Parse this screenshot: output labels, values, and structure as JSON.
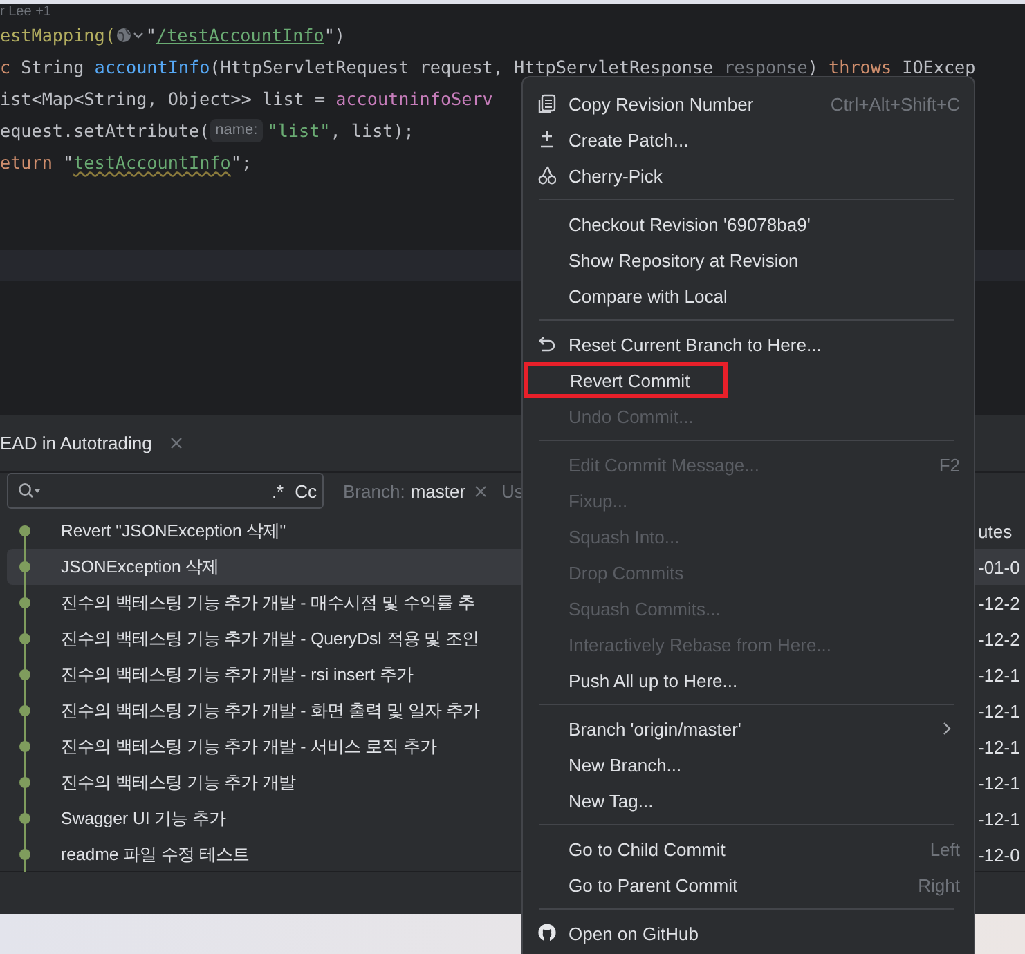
{
  "editor": {
    "author_hint": "r Lee +1",
    "lines": [
      [
        {
          "kind": "annotation",
          "text": "estMapping("
        },
        {
          "kind": "globe"
        },
        {
          "kind": "plain",
          "text": "\""
        },
        {
          "kind": "url",
          "text": "/testAccountInfo"
        },
        {
          "kind": "plain",
          "text": "\")"
        }
      ],
      [
        {
          "kind": "keyword",
          "text": "c "
        },
        {
          "kind": "plain",
          "text": "String "
        },
        {
          "kind": "method",
          "text": "accountInfo"
        },
        {
          "kind": "plain",
          "text": "(HttpServletRequest request, HttpServletResponse "
        },
        {
          "kind": "param",
          "text": "response"
        },
        {
          "kind": "plain",
          "text": ") "
        },
        {
          "kind": "keyword",
          "text": "throws "
        },
        {
          "kind": "plain",
          "text": "IOExcep"
        }
      ],
      [
        {
          "kind": "plain",
          "text": "ist<Map<String, Object>> list = "
        },
        {
          "kind": "field",
          "text": "accoutninfoServ"
        }
      ],
      [
        {
          "kind": "plain",
          "text": "equest.setAttribute("
        },
        {
          "kind": "hint",
          "text": "name:"
        },
        {
          "kind": "string",
          "text": "\"list\""
        },
        {
          "kind": "plain",
          "text": ", list);"
        }
      ],
      [
        {
          "kind": "keyword",
          "text": "eturn "
        },
        {
          "kind": "plain",
          "text": "\""
        },
        {
          "kind": "warn",
          "text": "testAccountInfo"
        },
        {
          "kind": "plain",
          "text": "\";"
        }
      ]
    ]
  },
  "log": {
    "tab": {
      "label": "EAD in Autotrading"
    },
    "filter": {
      "regex": ".*",
      "case": "Cc"
    },
    "branch_filter": {
      "label": "Branch:",
      "value": "master"
    },
    "user_filter": "Us",
    "commits": [
      {
        "message": "Revert \"JSONException 삭제\"",
        "date": "utes",
        "selected": false
      },
      {
        "message": "JSONException 삭제",
        "date": "-01-0",
        "selected": true
      },
      {
        "message": "진수의 백테스팅 기능 추가 개발  - 매수시점 및 수익률 추",
        "date": "-12-2",
        "selected": false
      },
      {
        "message": "진수의 백테스팅 기능 추가 개발  - QueryDsl 적용 및 조인",
        "date": "-12-2",
        "selected": false
      },
      {
        "message": "진수의 백테스팅 기능 추가 개발  - rsi insert 추가",
        "date": "-12-1",
        "selected": false
      },
      {
        "message": "진수의 백테스팅 기능 추가 개발  - 화면 출력 및 일자 추가",
        "date": "-12-1",
        "selected": false
      },
      {
        "message": "진수의 백테스팅 기능 추가 개발  - 서비스 로직 추가",
        "date": "-12-1",
        "selected": false
      },
      {
        "message": "진수의 백테스팅 기능 추가 개발",
        "date": "-12-1",
        "selected": false
      },
      {
        "message": "Swagger UI 기능 추가",
        "date": "-12-1",
        "selected": false
      },
      {
        "message": "readme 파일 수정 테스트",
        "date": "-12-0",
        "selected": false
      }
    ]
  },
  "context_menu": [
    {
      "kind": "copy",
      "label": "Copy Revision Number",
      "shortcut": "Ctrl+Alt+Shift+C",
      "disabled": false,
      "highlighted": false
    },
    {
      "kind": "patch",
      "label": "Create Patch...",
      "disabled": false,
      "highlighted": false
    },
    {
      "kind": "cherry",
      "label": "Cherry-Pick",
      "disabled": false,
      "highlighted": false
    },
    {
      "kind": "separator"
    },
    {
      "kind": "plain",
      "label": "Checkout Revision '69078ba9'",
      "disabled": false,
      "highlighted": false
    },
    {
      "kind": "plain",
      "label": "Show Repository at Revision",
      "disabled": false,
      "highlighted": false
    },
    {
      "kind": "plain",
      "label": "Compare with Local",
      "disabled": false,
      "highlighted": false
    },
    {
      "kind": "separator"
    },
    {
      "kind": "reset",
      "label": "Reset Current Branch to Here...",
      "disabled": false,
      "highlighted": false
    },
    {
      "kind": "plain",
      "label": "Revert Commit",
      "disabled": false,
      "highlighted": true
    },
    {
      "kind": "plain",
      "label": "Undo Commit...",
      "disabled": true,
      "highlighted": false
    },
    {
      "kind": "separator"
    },
    {
      "kind": "plain",
      "label": "Edit Commit Message...",
      "shortcut": "F2",
      "disabled": true,
      "highlighted": false
    },
    {
      "kind": "plain",
      "label": "Fixup...",
      "disabled": true,
      "highlighted": false
    },
    {
      "kind": "plain",
      "label": "Squash Into...",
      "disabled": true,
      "highlighted": false
    },
    {
      "kind": "plain",
      "label": "Drop Commits",
      "disabled": true,
      "highlighted": false
    },
    {
      "kind": "plain",
      "label": "Squash Commits...",
      "disabled": true,
      "highlighted": false
    },
    {
      "kind": "plain",
      "label": "Interactively Rebase from Here...",
      "disabled": true,
      "highlighted": false
    },
    {
      "kind": "plain",
      "label": "Push All up to Here...",
      "disabled": false,
      "highlighted": false
    },
    {
      "kind": "separator"
    },
    {
      "kind": "submenu",
      "label": "Branch 'origin/master'",
      "disabled": false,
      "highlighted": false
    },
    {
      "kind": "plain",
      "label": "New Branch...",
      "disabled": false,
      "highlighted": false
    },
    {
      "kind": "plain",
      "label": "New Tag...",
      "disabled": false,
      "highlighted": false
    },
    {
      "kind": "separator"
    },
    {
      "kind": "plain",
      "label": "Go to Child Commit",
      "shortcut": "Left",
      "disabled": false,
      "highlighted": false
    },
    {
      "kind": "plain",
      "label": "Go to Parent Commit",
      "shortcut": "Right",
      "disabled": false,
      "highlighted": false
    },
    {
      "kind": "separator"
    },
    {
      "kind": "github",
      "label": "Open on GitHub",
      "disabled": false,
      "highlighted": false
    }
  ]
}
